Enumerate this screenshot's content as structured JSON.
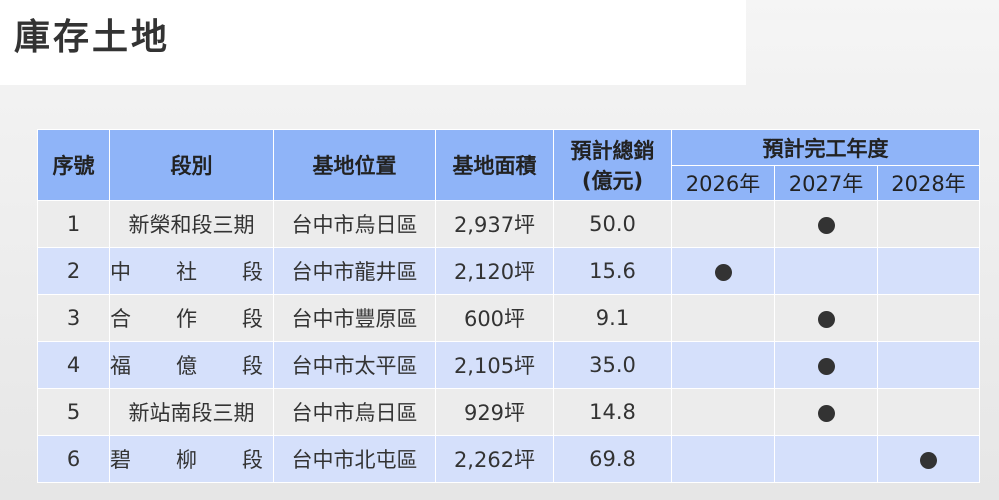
{
  "title": "庫存土地",
  "headers": {
    "no": "序號",
    "section": "段別",
    "location": "基地位置",
    "area": "基地面積",
    "sales_line1": "預計總銷",
    "sales_line2": "(億元)",
    "completion": "預計完工年度",
    "years": [
      "2026年",
      "2027年",
      "2028年"
    ]
  },
  "rows": [
    {
      "no": "1",
      "section_chars": [
        "新榮和段三期"
      ],
      "location": "台中市烏日區",
      "area": "2,937坪",
      "sales": "50.0",
      "completion_year": "2027年",
      "completion_index": 1
    },
    {
      "no": "2",
      "section_chars": [
        "中",
        "社",
        "段"
      ],
      "location": "台中市龍井區",
      "area": "2,120坪",
      "sales": "15.6",
      "completion_year": "2026年",
      "completion_index": 0
    },
    {
      "no": "3",
      "section_chars": [
        "合",
        "作",
        "段"
      ],
      "location": "台中市豐原區",
      "area": "600坪",
      "sales": "9.1",
      "completion_year": "2027年",
      "completion_index": 1
    },
    {
      "no": "4",
      "section_chars": [
        "福",
        "億",
        "段"
      ],
      "location": "台中市太平區",
      "area": "2,105坪",
      "sales": "35.0",
      "completion_year": "2027年",
      "completion_index": 1
    },
    {
      "no": "5",
      "section_chars": [
        "新站南段三期"
      ],
      "location": "台中市烏日區",
      "area": "929坪",
      "sales": "14.8",
      "completion_year": "2027年",
      "completion_index": 1
    },
    {
      "no": "6",
      "section_chars": [
        "碧",
        "柳",
        "段"
      ],
      "location": "台中市北屯區",
      "area": "2,262坪",
      "sales": "69.8",
      "completion_year": "2028年",
      "completion_index": 2
    }
  ],
  "colors": {
    "header_bg": "#8fb4f8",
    "row_odd_bg": "#ececec",
    "row_even_bg": "#d5e0fb",
    "dot": "#333333"
  }
}
